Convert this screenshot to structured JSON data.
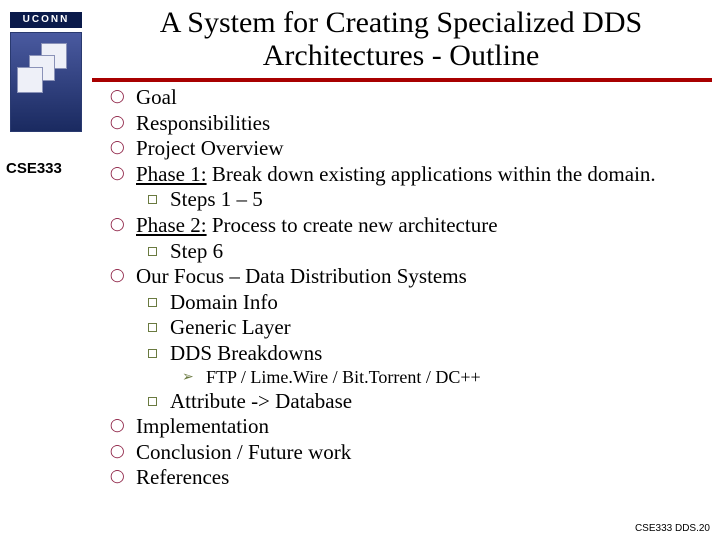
{
  "header": {
    "title": "A System for Creating Specialized DDS Architectures - Outline",
    "uconn_word": "UCONN",
    "course": "CSE333"
  },
  "outline": [
    {
      "text": "Goal"
    },
    {
      "text": "Responsibilities"
    },
    {
      "text": "Project Overview"
    },
    {
      "prefix": "Phase 1:",
      "text": " Break down existing applications within the domain.",
      "sub": [
        {
          "kind": "square",
          "text": "Steps 1 – 5"
        }
      ]
    },
    {
      "prefix": "Phase 2:",
      "text": " Process to create new architecture",
      "sub": [
        {
          "kind": "square",
          "text": "Step 6"
        }
      ]
    },
    {
      "text": "Our Focus – Data Distribution Systems",
      "sub": [
        {
          "kind": "square",
          "text": "Domain Info"
        },
        {
          "kind": "square",
          "text": "Generic Layer"
        },
        {
          "kind": "square",
          "text": "DDS Breakdowns",
          "sub": [
            {
              "kind": "arrow",
              "text": "FTP / Lime.Wire / Bit.Torrent / DC++"
            }
          ]
        },
        {
          "kind": "square",
          "text": "Attribute -> Database"
        }
      ]
    },
    {
      "text": "Implementation"
    },
    {
      "text": "Conclusion / Future work"
    },
    {
      "text": "References"
    }
  ],
  "footer": "CSE333 DDS.20"
}
